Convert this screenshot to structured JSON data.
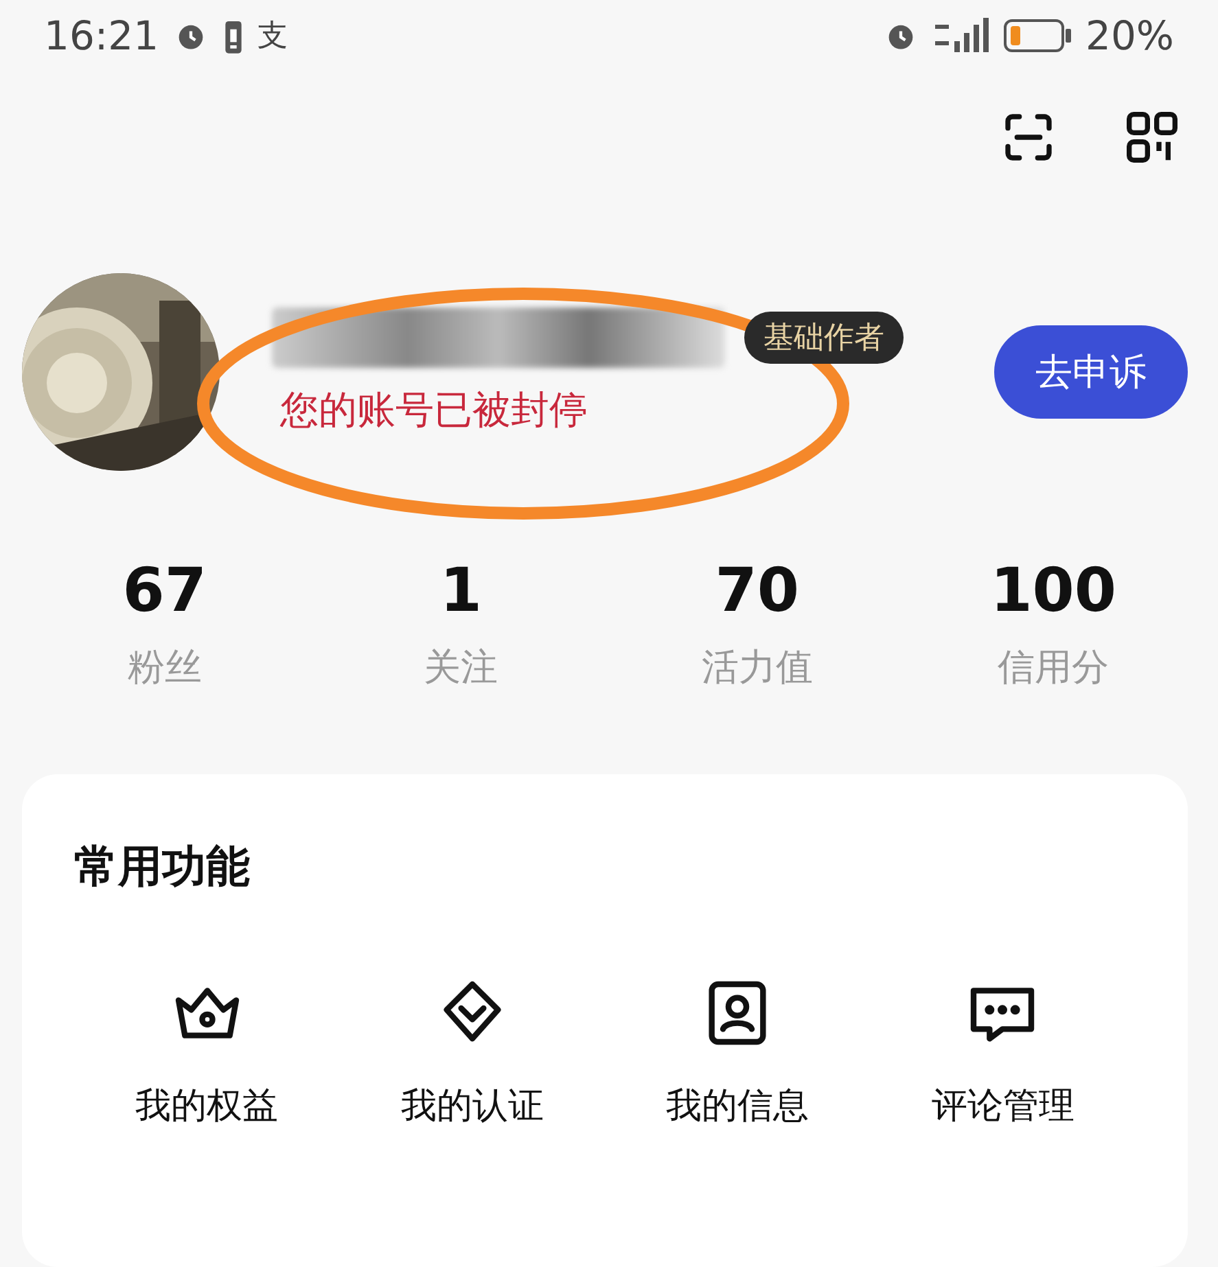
{
  "status_bar": {
    "time": "16:21",
    "app_glyph": "支",
    "battery": "20%"
  },
  "profile": {
    "badge": "基础作者",
    "status_message": "您的账号已被封停",
    "appeal_button": "去申诉"
  },
  "stats": [
    {
      "value": "67",
      "label": "粉丝"
    },
    {
      "value": "1",
      "label": "关注"
    },
    {
      "value": "70",
      "label": "活力值"
    },
    {
      "value": "100",
      "label": "信用分"
    }
  ],
  "functions": {
    "title": "常用功能",
    "items": [
      {
        "kind": "crown",
        "label": "我的权益"
      },
      {
        "kind": "shield",
        "label": "我的认证"
      },
      {
        "kind": "id",
        "label": "我的信息"
      },
      {
        "kind": "comment",
        "label": "评论管理"
      }
    ]
  }
}
